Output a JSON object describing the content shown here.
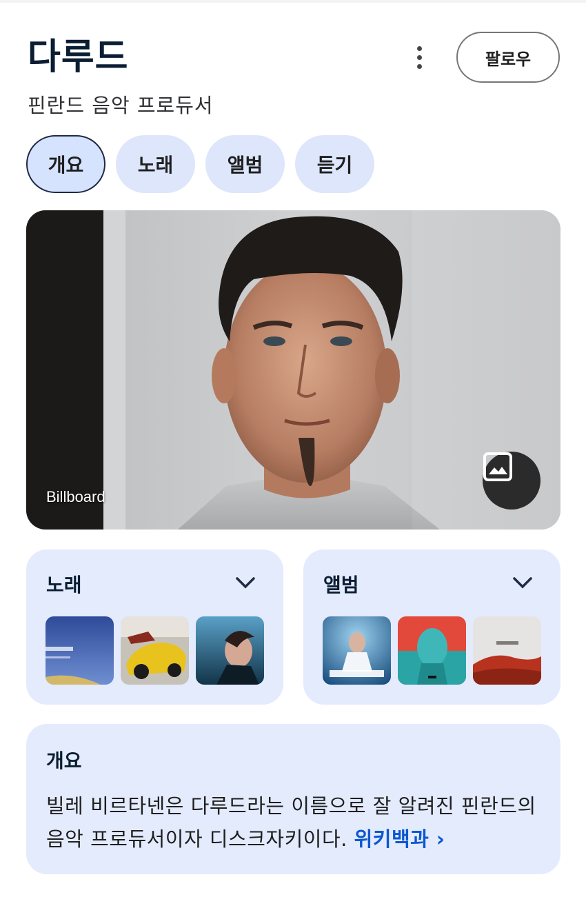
{
  "header": {
    "title": "다루드",
    "subtitle": "핀란드 음악 프로듀서",
    "follow_label": "팔로우"
  },
  "tabs": [
    {
      "label": "개요",
      "active": true
    },
    {
      "label": "노래",
      "active": false
    },
    {
      "label": "앨범",
      "active": false
    },
    {
      "label": "듣기",
      "active": false
    }
  ],
  "hero": {
    "credit": "Billboard",
    "gallery_icon": "image-icon"
  },
  "songs": {
    "title": "노래",
    "expand_icon": "chevron-down-icon"
  },
  "albums": {
    "title": "앨범",
    "expand_icon": "chevron-down-icon"
  },
  "overview": {
    "title": "개요",
    "text": "빌레 비르타넨은 다루드라는 이름으로 잘 알려진 핀란드의 음악 프로듀서이자 디스크자키이다.",
    "link_label": "위키백과 ›"
  },
  "colors": {
    "accent": "#0b57d0",
    "card_bg": "#e3ebfd",
    "tab_bg": "#dde6fb",
    "title": "#0b1d33"
  }
}
